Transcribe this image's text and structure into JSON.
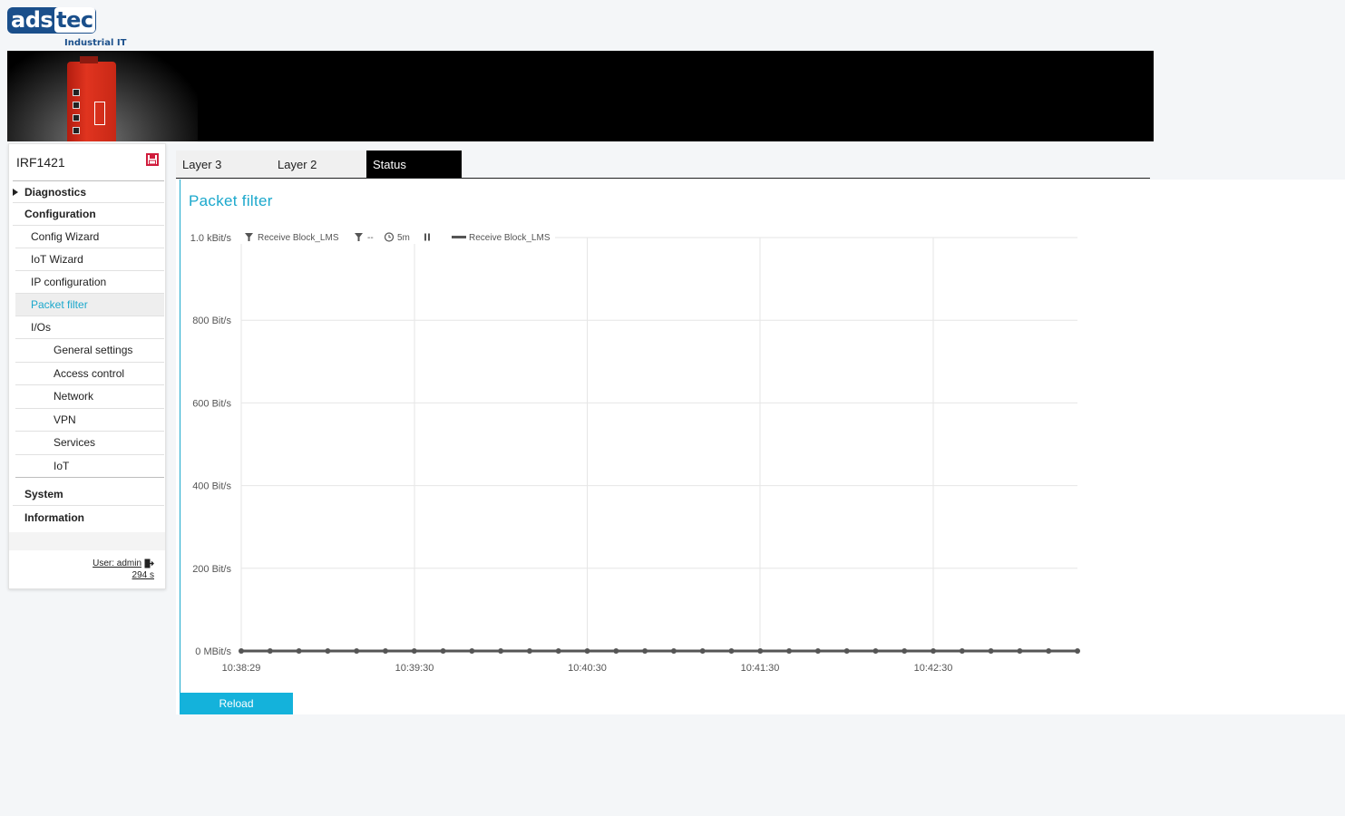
{
  "brand": {
    "logo_main": "ads",
    "logo_tec": "tec",
    "logo_sub": "Industrial IT",
    "primary": "#1a4f8b",
    "accent": "#1ba8cc"
  },
  "device": {
    "name": "IRF1421"
  },
  "nav": {
    "diagnostics": "Diagnostics",
    "configuration": "Configuration",
    "config_wizard": "Config Wizard",
    "iot_wizard": "IoT Wizard",
    "ip_configuration": "IP configuration",
    "packet_filter": "Packet filter",
    "ios": "I/Os",
    "general_settings": "General settings",
    "access_control": "Access control",
    "network": "Network",
    "vpn": "VPN",
    "services": "Services",
    "iot": "IoT",
    "system": "System",
    "information": "Information"
  },
  "session": {
    "user": "User: admin",
    "timer": "294 s"
  },
  "tabs": [
    "Layer 3",
    "Layer 2",
    "Status"
  ],
  "active_tab": "Status",
  "page_title": "Packet filter",
  "toolbar": {
    "filter_label": "Receive Block_LMS",
    "filter2_label": "--",
    "interval": "5m",
    "legend": "Receive Block_LMS"
  },
  "reload_label": "Reload",
  "chart_data": {
    "type": "line",
    "ylim": [
      0,
      1000
    ],
    "y_tick_labels": [
      "0 MBit/s",
      "200 Bit/s",
      "400 Bit/s",
      "600 Bit/s",
      "800 Bit/s",
      "1.0 kBit/s"
    ],
    "y_tick_values": [
      0,
      200,
      400,
      600,
      800,
      1000
    ],
    "x_tick_labels": [
      "10:38:29",
      "10:39:30",
      "10:40:30",
      "10:41:30",
      "10:42:30"
    ],
    "series": [
      {
        "name": "Receive Block_LMS",
        "color": "#555555",
        "values": [
          0,
          0,
          0,
          0,
          0,
          0,
          0,
          0,
          0,
          0,
          0,
          0,
          0,
          0,
          0,
          0,
          0,
          0,
          0,
          0,
          0,
          0,
          0,
          0,
          0,
          0,
          0,
          0,
          0,
          0
        ]
      }
    ],
    "grid": true,
    "legend": "top"
  }
}
